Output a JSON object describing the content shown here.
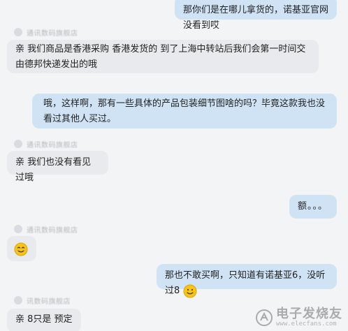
{
  "messages": [
    {
      "text": "那你们是在哪儿拿货的，诺基亚官网没看到哎"
    },
    {
      "sender": "通讯数码旗舰店",
      "text": "亲 我们商品是香港采购 香港发货的 到了上海中转站后我们会第一时间交由德邦快递发出的哦"
    },
    {
      "text": "哦，这样啊，那有一些具体的产品包装细节图啥的吗？毕竟这款我也没看过其他人买过。"
    },
    {
      "sender": "通讯数码旗舰店",
      "text": "亲 我们也没有看见过哦"
    },
    {
      "text": "额。。。"
    },
    {
      "sender": "通讯数码旗舰店",
      "emoji": "smiley-emoji"
    },
    {
      "text": "那也不敢买啊，只知道有诺基亚6，没听过8"
    },
    {
      "sender": "讯数码旗舰店",
      "text": "亲 8只是 预定"
    }
  ],
  "watermark": {
    "main": "电子发烧友",
    "url": "www.elecfans.com"
  },
  "colors": {
    "incoming": "#e9eaed",
    "outgoing": "#cfe3f5",
    "background": "#f3f4f6"
  }
}
